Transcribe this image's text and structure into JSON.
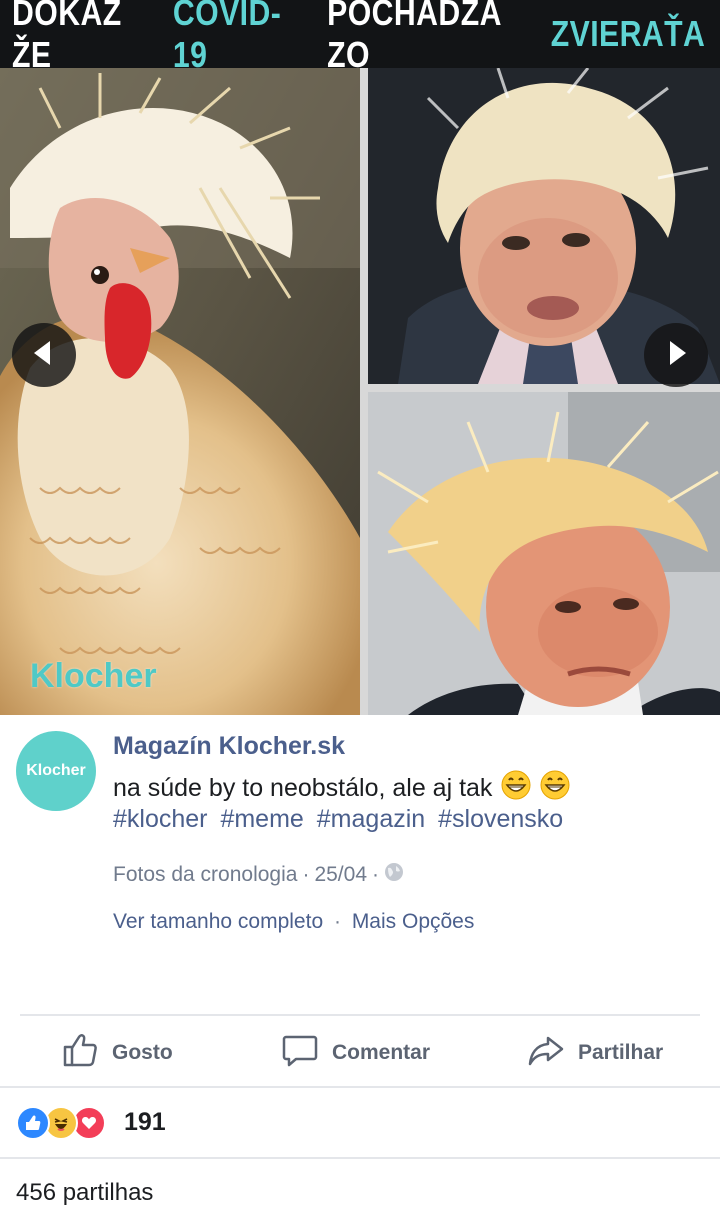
{
  "image": {
    "headline": {
      "part1": "DÔKAZ ŽE",
      "part2": "COVID-19",
      "part3": "POCHÁDZA ZO",
      "part4": "ZVIERAŤA"
    },
    "watermark": "Klocher"
  },
  "post": {
    "avatar_text": "Klocher",
    "page_name": "Magazín Klocher.sk",
    "caption": "na súde by to neobstálo, ale aj tak",
    "hashtags": [
      "#klocher",
      "#meme",
      "#magazin",
      "#slovensko"
    ],
    "album": "Fotos da cronologia",
    "date": "25/04",
    "view_full": "Ver tamanho completo",
    "more_options": "Mais Opções"
  },
  "actions": {
    "like": "Gosto",
    "comment": "Comentar",
    "share": "Partilhar"
  },
  "stats": {
    "reaction_count": "191",
    "shares": "456 partilhas"
  },
  "colors": {
    "accent": "#5fd3d3",
    "link": "#4b5f8c",
    "banner_bg": "#121416"
  }
}
